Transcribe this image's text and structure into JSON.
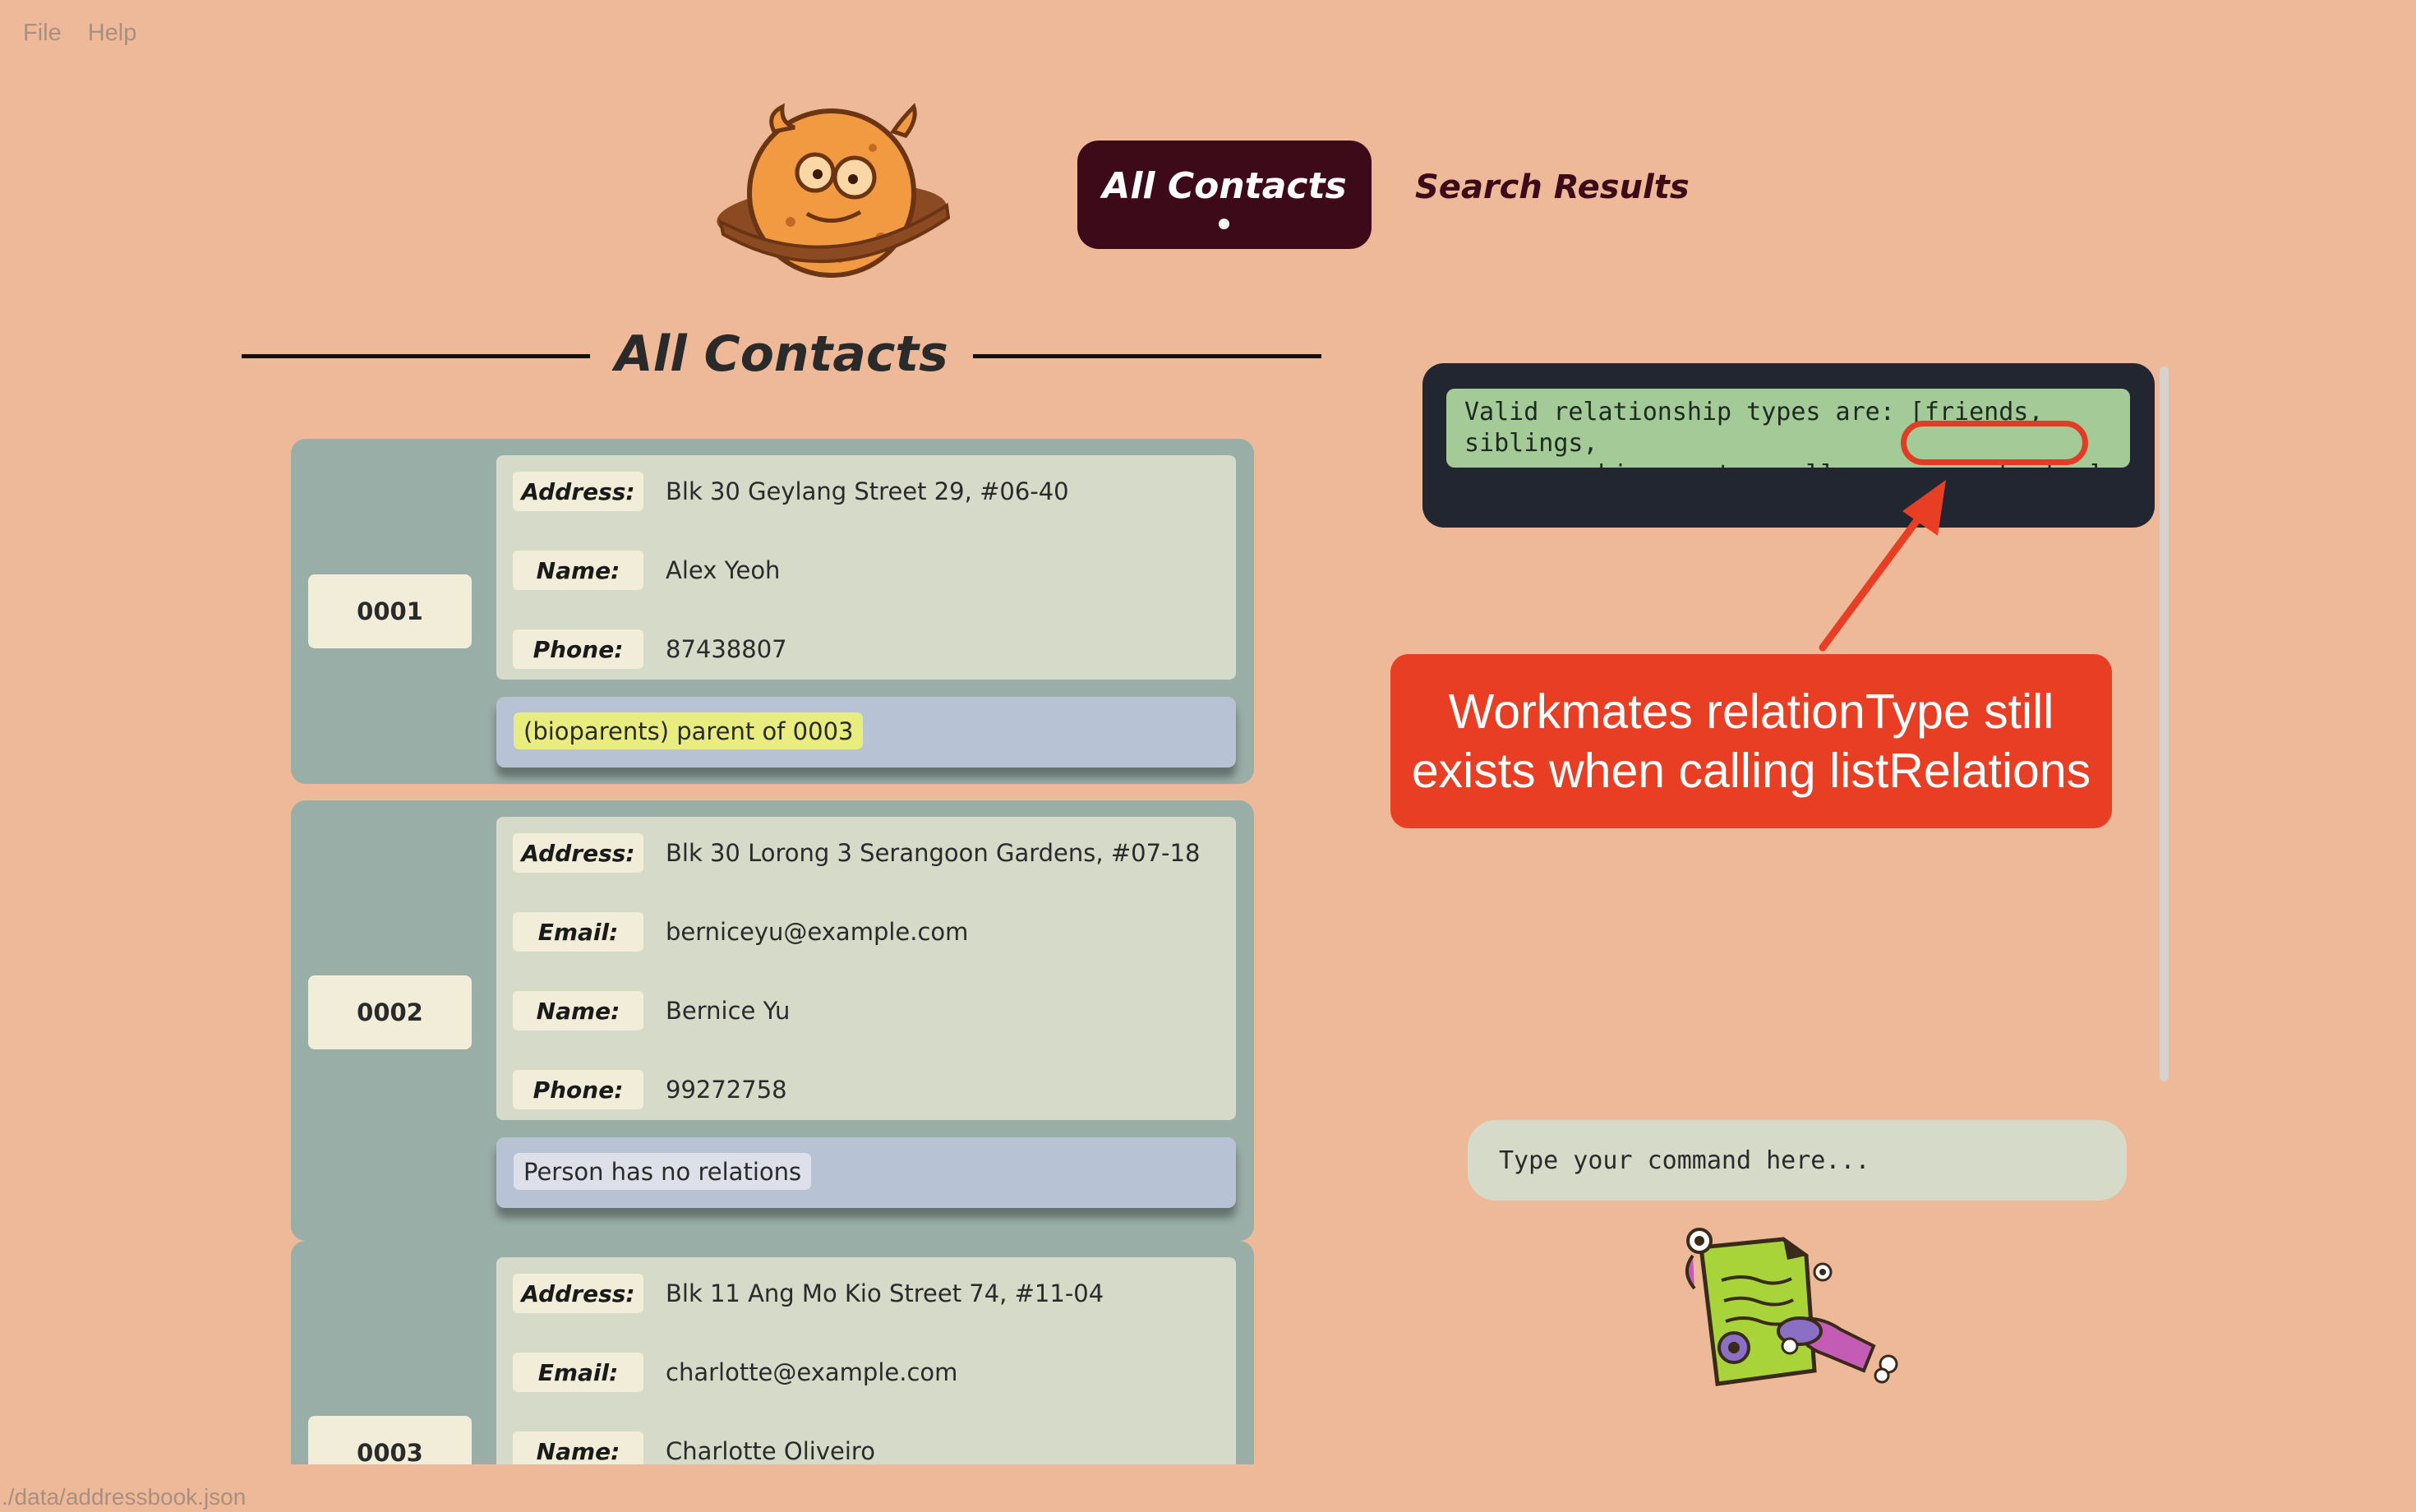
{
  "menu": {
    "file": "File",
    "help": "Help"
  },
  "tabs": {
    "all_contacts": "All Contacts",
    "search_results": "Search Results"
  },
  "section": {
    "title": "All Contacts"
  },
  "contacts": [
    {
      "id": "0001",
      "fields": [
        {
          "label": "Address:",
          "value": "Blk 30 Geylang Street 29, #06-40"
        },
        {
          "label": "Name:",
          "value": "Alex Yeoh"
        },
        {
          "label": "Phone:",
          "value": "87438807"
        }
      ],
      "relations": "(bioparents) parent of 0003"
    },
    {
      "id": "0002",
      "fields": [
        {
          "label": "Address:",
          "value": "Blk 30 Lorong 3 Serangoon Gardens, #07-18"
        },
        {
          "label": "Email:",
          "value": "berniceyu@example.com"
        },
        {
          "label": "Name:",
          "value": "Bernice Yu"
        },
        {
          "label": "Phone:",
          "value": "99272758"
        }
      ],
      "relations": "Person has no relations"
    },
    {
      "id": "0003",
      "fields": [
        {
          "label": "Address:",
          "value": "Blk 11 Ang Mo Kio Street 74, #11-04"
        },
        {
          "label": "Email:",
          "value": "charlotte@example.com"
        },
        {
          "label": "Name:",
          "value": "Charlotte Oliveiro"
        }
      ]
    }
  ],
  "result": {
    "line1": "Valid relationship types are: [friends, siblings,",
    "line2": "spouses, bioparents, colleagues, workmates]"
  },
  "callout": {
    "line1": "Workmates relationType still",
    "line2": "exists when calling listRelations"
  },
  "command": {
    "placeholder": "Type your command here..."
  },
  "status": {
    "file_path": "./data/addressbook.json"
  },
  "colors": {
    "background": "#eeb999",
    "tab_active": "#3d0a19",
    "callout": "#e83e24",
    "result_box": "#212630",
    "result_text_bg": "#a4ca98",
    "relation_highlight": "#e9ec7f"
  },
  "icons": [
    "planet-mascot-icon",
    "document-mascot-icon",
    "arrow-icon"
  ]
}
